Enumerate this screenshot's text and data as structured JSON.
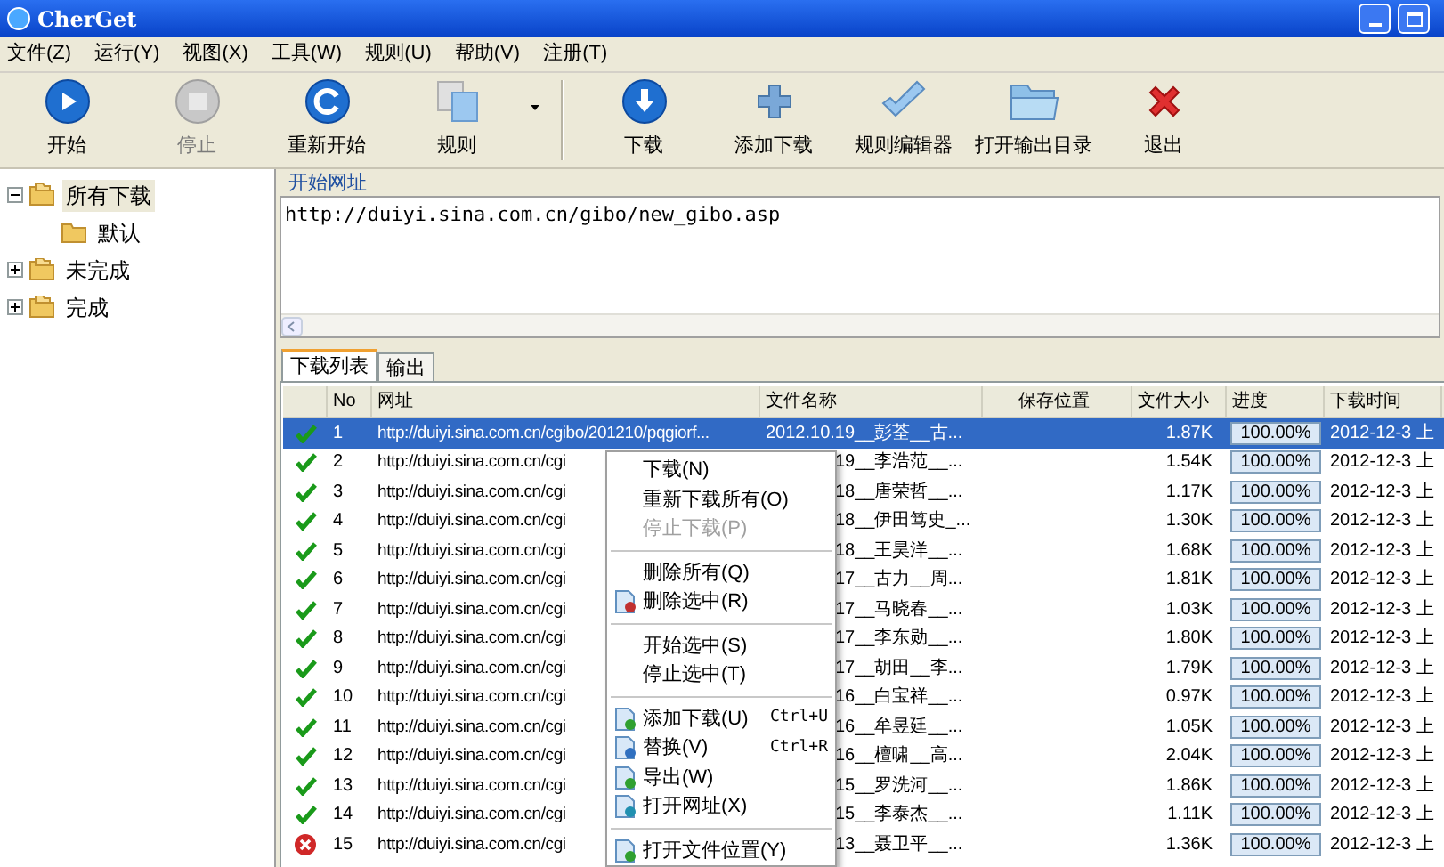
{
  "window": {
    "title": "CherGet"
  },
  "menu": [
    "文件(Z)",
    "运行(Y)",
    "视图(X)",
    "工具(W)",
    "规则(U)",
    "帮助(V)",
    "注册(T)"
  ],
  "toolbar": [
    {
      "kind": "button",
      "label": "开始",
      "disabled": false,
      "dropdown": false
    },
    {
      "kind": "button",
      "label": "停止",
      "disabled": true,
      "dropdown": false
    },
    {
      "kind": "button",
      "label": "重新开始",
      "disabled": false,
      "dropdown": false
    },
    {
      "kind": "button",
      "label": "规则",
      "disabled": false,
      "dropdown": true
    },
    {
      "kind": "separator"
    },
    {
      "kind": "button",
      "label": "下载",
      "disabled": false,
      "dropdown": false
    },
    {
      "kind": "button",
      "label": "添加下载",
      "disabled": false,
      "dropdown": false
    },
    {
      "kind": "button",
      "label": "规则编辑器",
      "disabled": false,
      "dropdown": false
    },
    {
      "kind": "button",
      "label": "打开输出目录",
      "disabled": false,
      "dropdown": false
    },
    {
      "kind": "button",
      "label": "退出",
      "disabled": false,
      "dropdown": false
    }
  ],
  "tree": [
    {
      "label": "所有下载",
      "selected": true,
      "expanded": true,
      "children": [
        {
          "label": "默认",
          "selected": false
        }
      ]
    },
    {
      "label": "未完成",
      "selected": false,
      "expanded": false
    },
    {
      "label": "完成",
      "selected": false,
      "expanded": false
    }
  ],
  "start_url": {
    "label": "开始网址",
    "value": "http://duiyi.sina.com.cn/gibo/new_gibo.asp"
  },
  "tabs": [
    {
      "label": "下载列表",
      "selected": true
    },
    {
      "label": "输出",
      "selected": false
    }
  ],
  "table": {
    "columns": [
      "No",
      "网址",
      "文件名称",
      "保存位置",
      "文件大小",
      "进度",
      "下载时间"
    ],
    "rows": [
      {
        "done": true,
        "selected": true,
        "no": "1",
        "url": "http://duiyi.sina.com.cn/cgibo/201210/pqgiorf...",
        "file": "2012.10.19__彭荃__古...",
        "size": "1.87K",
        "progress": "100.00%",
        "level": 1,
        "time": "2012-12-3 上"
      },
      {
        "done": true,
        "selected": false,
        "no": "2",
        "url": "http://duiyi.sina.com.cn/cgi",
        "file": "19__李浩范__...",
        "size": "1.54K",
        "progress": "100.00%",
        "level": 1,
        "time": "2012-12-3 上"
      },
      {
        "done": true,
        "selected": false,
        "no": "3",
        "url": "http://duiyi.sina.com.cn/cgi",
        "file": "18__唐荣哲__...",
        "size": "1.17K",
        "progress": "100.00%",
        "level": 1,
        "time": "2012-12-3 上"
      },
      {
        "done": true,
        "selected": false,
        "no": "4",
        "url": "http://duiyi.sina.com.cn/cgi",
        "file": "18__伊田笃史_...",
        "size": "1.30K",
        "progress": "100.00%",
        "level": 1,
        "time": "2012-12-3 上"
      },
      {
        "done": true,
        "selected": false,
        "no": "5",
        "url": "http://duiyi.sina.com.cn/cgi",
        "file": "18__王昊洋__...",
        "size": "1.68K",
        "progress": "100.00%",
        "level": 1,
        "time": "2012-12-3 上"
      },
      {
        "done": true,
        "selected": false,
        "no": "6",
        "url": "http://duiyi.sina.com.cn/cgi",
        "file": "17__古力__周...",
        "size": "1.81K",
        "progress": "100.00%",
        "level": 1,
        "time": "2012-12-3 上"
      },
      {
        "done": true,
        "selected": false,
        "no": "7",
        "url": "http://duiyi.sina.com.cn/cgi",
        "file": "17__马晓春__...",
        "size": "1.03K",
        "progress": "100.00%",
        "level": 1,
        "time": "2012-12-3 上"
      },
      {
        "done": true,
        "selected": false,
        "no": "8",
        "url": "http://duiyi.sina.com.cn/cgi",
        "file": "17__李东勋__...",
        "size": "1.80K",
        "progress": "100.00%",
        "level": 1,
        "time": "2012-12-3 上"
      },
      {
        "done": true,
        "selected": false,
        "no": "9",
        "url": "http://duiyi.sina.com.cn/cgi",
        "file": "17__胡田__李...",
        "size": "1.79K",
        "progress": "100.00%",
        "level": 1,
        "time": "2012-12-3 上"
      },
      {
        "done": true,
        "selected": false,
        "no": "10",
        "url": "http://duiyi.sina.com.cn/cgi",
        "file": "16__白宝祥__...",
        "size": "0.97K",
        "progress": "100.00%",
        "level": 1,
        "time": "2012-12-3 上"
      },
      {
        "done": true,
        "selected": false,
        "no": "11",
        "url": "http://duiyi.sina.com.cn/cgi",
        "file": "16__牟昱廷__...",
        "size": "1.05K",
        "progress": "100.00%",
        "level": 1,
        "time": "2012-12-3 上"
      },
      {
        "done": true,
        "selected": false,
        "no": "12",
        "url": "http://duiyi.sina.com.cn/cgi",
        "file": "16__檀啸__高...",
        "size": "2.04K",
        "progress": "100.00%",
        "level": 1,
        "time": "2012-12-3 上"
      },
      {
        "done": true,
        "selected": false,
        "no": "13",
        "url": "http://duiyi.sina.com.cn/cgi",
        "file": "15__罗洗河__...",
        "size": "1.86K",
        "progress": "100.00%",
        "level": 1,
        "time": "2012-12-3 上"
      },
      {
        "done": true,
        "selected": false,
        "no": "14",
        "url": "http://duiyi.sina.com.cn/cgi",
        "file": "15__李泰杰__...",
        "size": "1.11K",
        "progress": "100.00%",
        "level": 1,
        "time": "2012-12-3 上"
      },
      {
        "done": false,
        "selected": false,
        "no": "15",
        "url": "http://duiyi.sina.com.cn/cgi",
        "file": "13__聂卫平__...",
        "size": "1.36K",
        "progress": "100.00%",
        "level": 1,
        "time": "2012-12-3 上"
      }
    ]
  },
  "context_menu": [
    {
      "kind": "item",
      "label": "下载(N)",
      "disabled": false
    },
    {
      "kind": "item",
      "label": "重新下载所有(O)",
      "disabled": false
    },
    {
      "kind": "item",
      "label": "停止下载(P)",
      "disabled": true
    },
    {
      "kind": "separator"
    },
    {
      "kind": "item",
      "label": "删除所有(Q)",
      "disabled": false
    },
    {
      "kind": "item",
      "label": "删除选中(R)",
      "disabled": false
    },
    {
      "kind": "separator"
    },
    {
      "kind": "item",
      "label": "开始选中(S)",
      "disabled": false
    },
    {
      "kind": "item",
      "label": "停止选中(T)",
      "disabled": false
    },
    {
      "kind": "separator"
    },
    {
      "kind": "item",
      "label": "添加下载(U)",
      "shortcut": "Ctrl+U",
      "disabled": false
    },
    {
      "kind": "item",
      "label": "替换(V)",
      "shortcut": "Ctrl+R",
      "disabled": false
    },
    {
      "kind": "item",
      "label": "导出(W)",
      "disabled": false
    },
    {
      "kind": "item",
      "label": "打开网址(X)",
      "disabled": false
    },
    {
      "kind": "separator"
    },
    {
      "kind": "item",
      "label": "打开文件位置(Y)",
      "disabled": false
    }
  ]
}
